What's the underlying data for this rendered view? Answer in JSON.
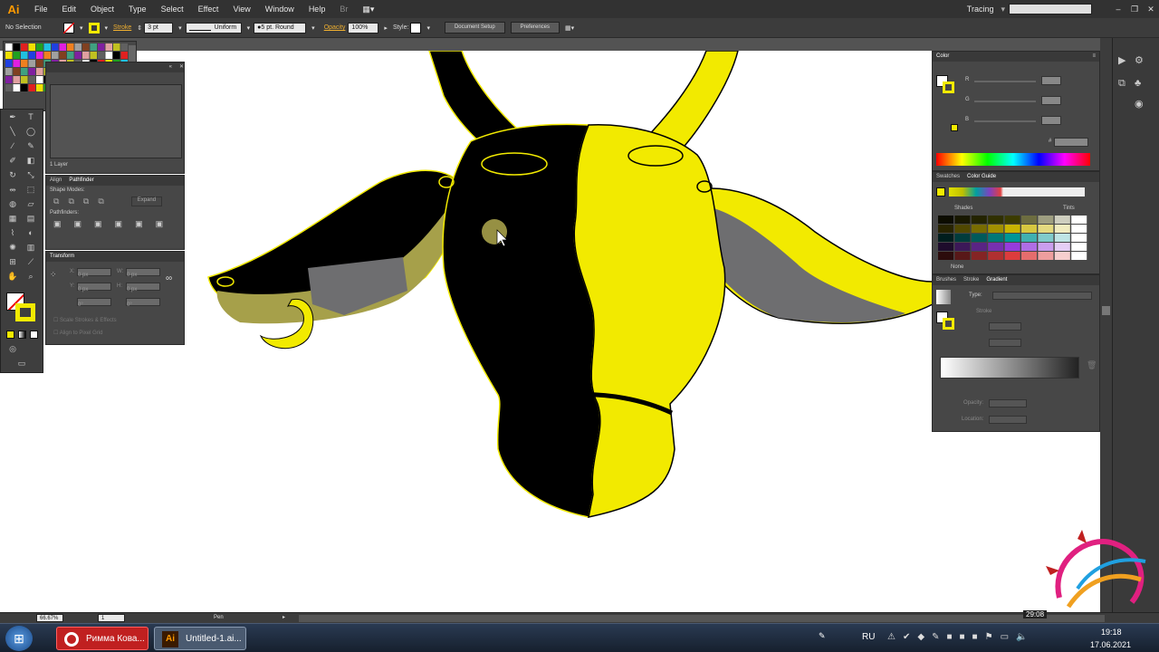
{
  "app": {
    "logo": "Ai"
  },
  "menu": [
    "File",
    "Edit",
    "Object",
    "Type",
    "Select",
    "Effect",
    "View",
    "Window",
    "Help"
  ],
  "workspace": {
    "label": "Tracing",
    "search_placeholder": ""
  },
  "control_bar": {
    "selection": "No Selection",
    "stroke_label": "Stroke",
    "stroke_value": "3 pt",
    "profile": "Uniform",
    "brush": "5 pt. Round",
    "opacity_label": "Opacity",
    "opacity_value": "100%",
    "style_label": "Style:",
    "doc_setup": "Document Setup",
    "preferences": "Preferences"
  },
  "layers_panel": {
    "count": "1 Layer"
  },
  "pathfinder_panel": {
    "tabs": [
      "Align",
      "Pathfinder"
    ],
    "shape_modes": "Shape Modes:",
    "expand": "Expand",
    "pathfinders": "Pathfinders:"
  },
  "transform_panel": {
    "title": "Transform",
    "x_label": "X:",
    "x_value": "0 px",
    "y_label": "Y:",
    "y_value": "0 px",
    "w_label": "W:",
    "w_value": "0 px",
    "h_label": "H:",
    "h_value": "0 px",
    "angle_value": "0°",
    "shear_value": "0°",
    "scale_strokes": "Scale Strokes & Effects",
    "pixel_grid": "Align to Pixel Grid"
  },
  "color_panel": {
    "title": "Color",
    "r": "R",
    "g": "G",
    "b": "B",
    "hex_prefix": "#"
  },
  "swatch_tabs": {
    "swatches": "Swatches",
    "guide": "Color Guide"
  },
  "color_guide": {
    "shades": "Shades",
    "tints": "Tints",
    "none": "None"
  },
  "gradient_panel": {
    "tabs": [
      "Brushes",
      "Stroke",
      "Gradient"
    ],
    "type_label": "Type:",
    "stroke_label": "Stroke",
    "opacity_label": "Opacity:",
    "location_label": "Location:"
  },
  "status": {
    "zoom": "66.67%",
    "page": "1",
    "tool": "Pen"
  },
  "taskbar": {
    "app1": "Римма Кова...",
    "app2": "Untitled-1.ai...",
    "lang": "RU",
    "time": "19:18",
    "date": "17.06.2021",
    "video_time": "29:08"
  },
  "colors": {
    "yellow": "#f2ea00",
    "black": "#000000",
    "olive": "#a6a04a",
    "grey": "#6e6e70"
  }
}
